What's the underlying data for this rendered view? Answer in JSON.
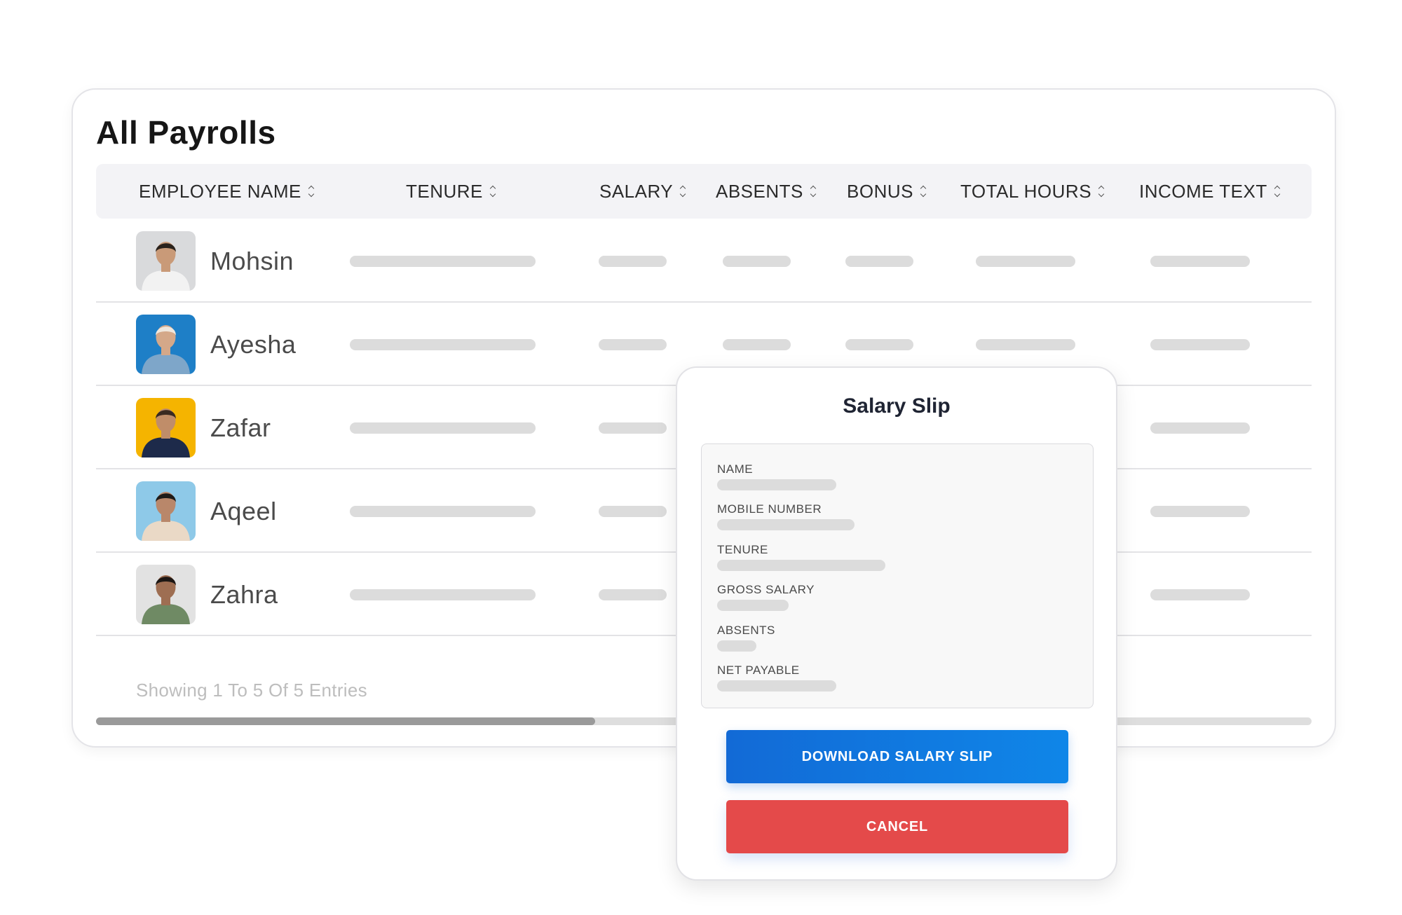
{
  "page": {
    "title": "All Payrolls"
  },
  "table": {
    "headers": [
      "EMPLOYEE NAME",
      "TENURE",
      "SALARY",
      "ABSENTS",
      "BONUS",
      "TOTAL HOURS",
      "INCOME TEXT"
    ],
    "rows": [
      {
        "name": "Mohsin",
        "avatar_bg": "#d9dadc",
        "shirt": "#f2f2f2",
        "skin": "#c99a78",
        "hair": "#2a221c"
      },
      {
        "name": "Ayesha",
        "avatar_bg": "#1e7fc7",
        "shirt": "#7ea6c9",
        "skin": "#d4a889",
        "hair": "#efe7dd"
      },
      {
        "name": "Zafar",
        "avatar_bg": "#f5b400",
        "shirt": "#1d2a4a",
        "skin": "#c08d69",
        "hair": "#3a2a20"
      },
      {
        "name": "Aqeel",
        "avatar_bg": "#8ec9e8",
        "shirt": "#ead9c6",
        "skin": "#b9876a",
        "hair": "#1e1b19"
      },
      {
        "name": "Zahra",
        "avatar_bg": "#e2e2e2",
        "shirt": "#6f8a64",
        "skin": "#9e6e52",
        "hair": "#1d1714"
      }
    ]
  },
  "footer": {
    "entries_text": "Showing 1 To 5 Of 5 Entries"
  },
  "modal": {
    "title": "Salary Slip",
    "fields": [
      "NAME",
      "MOBILE NUMBER",
      "TENURE",
      "GROSS SALARY",
      "ABSENTS",
      "NET PAYABLE"
    ],
    "download_label": "DOWNLOAD SALARY SLIP",
    "cancel_label": "CANCEL"
  },
  "colors": {
    "primary": "#126ad6",
    "danger": "#e44a4a",
    "placeholder": "#dcdcdc"
  }
}
